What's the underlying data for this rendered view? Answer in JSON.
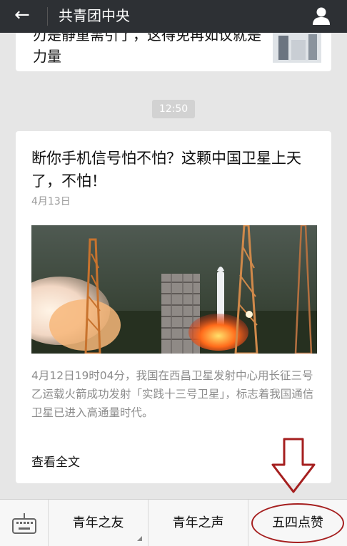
{
  "header": {
    "back_icon": "arrow-left-icon",
    "title": "共青团中央",
    "user_icon": "user-icon"
  },
  "prev_card": {
    "text": "刃是静重需引了，这得免再如议就是力量"
  },
  "time_label": "12:50",
  "article": {
    "title": "断你手机信号怕不怕？这颗中国卫星上天了，不怕！",
    "date": "4月13日",
    "image": "rocket-launch-photo",
    "excerpt": "4月12日19时04分，我国在西昌卫星发射中心用长征三号乙运载火箭成功发射「实践十三号卫星」，标志着我国通信卫星已进入高通量时代。",
    "read_more": "查看全文"
  },
  "bottom_menu": {
    "keyboard_icon": "keyboard-icon",
    "items": [
      {
        "label": "青年之友"
      },
      {
        "label": "青年之声"
      },
      {
        "label": "五四点赞"
      }
    ]
  },
  "annotation": {
    "arrow_color": "#a51f1f"
  }
}
